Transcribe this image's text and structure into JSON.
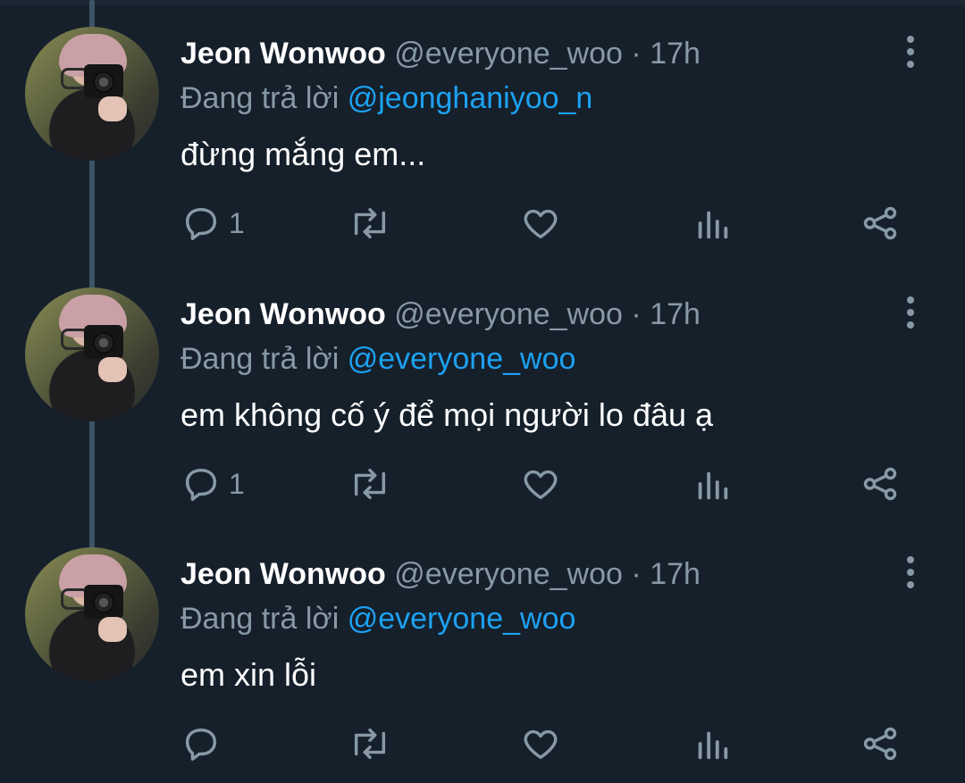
{
  "tweets": [
    {
      "name": "Jeon Wonwoo",
      "handle": "@everyone_woo",
      "dot": "·",
      "time": "17h",
      "reply_prefix": "Đang trả lời",
      "reply_to": "@jeonghaniyoo_n",
      "text": "đừng mắng em...",
      "reply_count": "1"
    },
    {
      "name": "Jeon Wonwoo",
      "handle": "@everyone_woo",
      "dot": "·",
      "time": "17h",
      "reply_prefix": "Đang trả lời",
      "reply_to": "@everyone_woo",
      "text": "em không cố ý để mọi người lo đâu ạ",
      "reply_count": "1"
    },
    {
      "name": "Jeon Wonwoo",
      "handle": "@everyone_woo",
      "dot": "·",
      "time": "17h",
      "reply_prefix": "Đang trả lời",
      "reply_to": "@everyone_woo",
      "text": "em xin lỗi",
      "reply_count": ""
    }
  ],
  "icons": {
    "reply": "reply-icon",
    "retweet": "retweet-icon",
    "like": "heart-icon",
    "views": "analytics-icon",
    "share": "share-icon",
    "more": "more-vertical-icon"
  },
  "colors": {
    "background": "#15202b",
    "text": "#ffffff",
    "muted": "#8899a6",
    "link": "#1da1f2",
    "thread_line": "#3d5466"
  }
}
